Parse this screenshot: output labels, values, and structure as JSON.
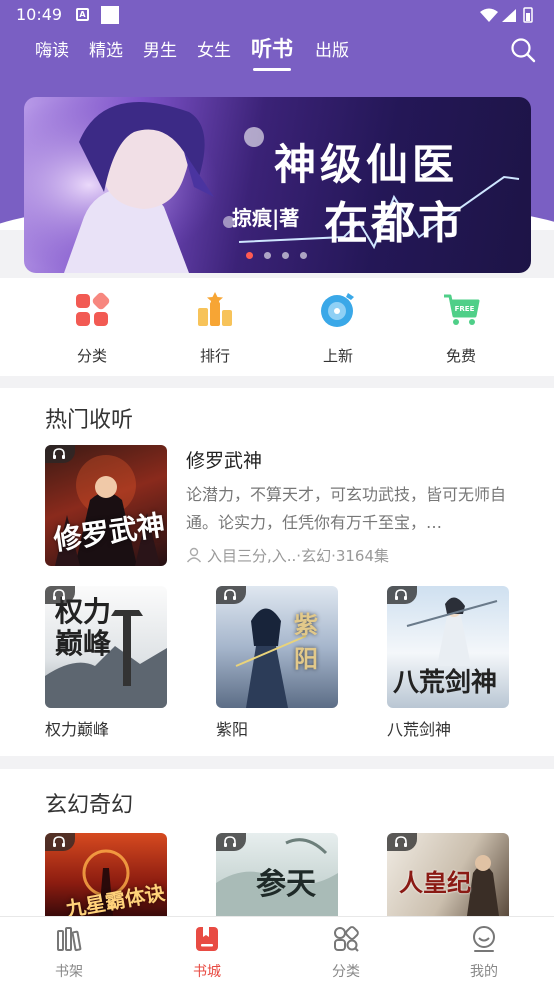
{
  "status": {
    "time": "10:49",
    "a_badge": "A"
  },
  "topnav": {
    "tabs": [
      {
        "label": "嗨读",
        "active": false
      },
      {
        "label": "精选",
        "active": false
      },
      {
        "label": "男生",
        "active": false
      },
      {
        "label": "女生",
        "active": false
      },
      {
        "label": "听书",
        "active": true
      },
      {
        "label": "出版",
        "active": false
      }
    ],
    "search_icon": "search-icon"
  },
  "banner": {
    "title_line1": "神级仙医",
    "author": "掠痕|著",
    "title_line2": "在都市",
    "dots": 4,
    "active_dot": 0
  },
  "quick_links": [
    {
      "label": "分类",
      "icon": "category-icon",
      "color": "#f25a53"
    },
    {
      "label": "排行",
      "icon": "ranking-icon",
      "color": "#f7a534"
    },
    {
      "label": "上新",
      "icon": "new-release-icon",
      "color": "#3aa8e8"
    },
    {
      "label": "免费",
      "icon": "free-cart-icon",
      "color": "#4fcf88"
    }
  ],
  "hot_section": {
    "title": "热门收听",
    "featured": {
      "title": "修罗武神",
      "cover_text": "修罗武神",
      "description": "论潜力，不算天才，可玄功武技，皆可无师自通。论实力，任凭你有万千至宝，…",
      "meta": "入目三分,入..·玄幻·3164集"
    },
    "books": [
      {
        "title": "权力巅峰",
        "cover_text": "权力巅峰"
      },
      {
        "title": "紫阳",
        "cover_text": "紫阳"
      },
      {
        "title": "八荒剑神",
        "cover_text": "八荒剑神"
      }
    ]
  },
  "fantasy_section": {
    "title": "玄幻奇幻",
    "books": [
      {
        "cover_text": "九星霸体诀"
      },
      {
        "cover_text": "参天"
      },
      {
        "cover_text": "人皇纪"
      }
    ]
  },
  "bottomnav": [
    {
      "label": "书架",
      "icon": "bookshelf-icon",
      "active": false
    },
    {
      "label": "书城",
      "icon": "bookstore-icon",
      "active": true
    },
    {
      "label": "分类",
      "icon": "category-grid-icon",
      "active": false
    },
    {
      "label": "我的",
      "icon": "profile-icon",
      "active": false
    }
  ],
  "colors": {
    "header": "#7a5fc3",
    "accent": "#e84b43"
  }
}
